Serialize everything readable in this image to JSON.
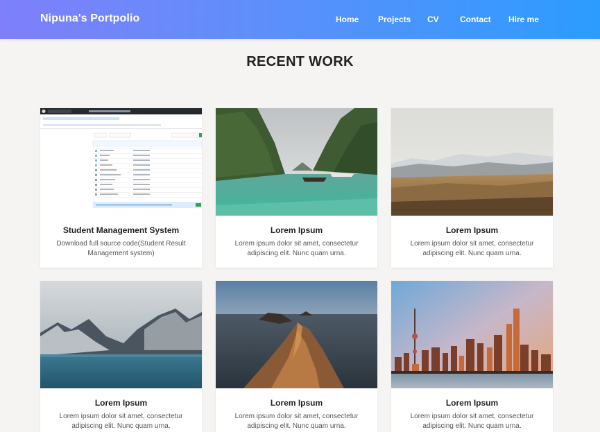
{
  "brand": "Nipuna's Portpolio",
  "nav": [
    {
      "label": "Home"
    },
    {
      "label": "Projects"
    },
    {
      "label": "CV"
    },
    {
      "label": "Contact"
    },
    {
      "label": "Hire me"
    }
  ],
  "section_title": "RECENT WORK",
  "cards": [
    {
      "title": "Student Management System",
      "desc": "Download full source code(Student Result Management system)",
      "image": "github-repo-screenshot"
    },
    {
      "title": "Lorem Ipsum",
      "desc": "Lorem ipsum dolor sit amet, consectetur adipiscing elit. Nunc quam urna.",
      "image": "tropical-lagoon-boats"
    },
    {
      "title": "Lorem Ipsum",
      "desc": "Lorem ipsum dolor sit amet, consectetur adipiscing elit. Nunc quam urna.",
      "image": "dry-hills-snow-mountains"
    },
    {
      "title": "Lorem Ipsum",
      "desc": "Lorem ipsum dolor sit amet, consectetur adipiscing elit. Nunc quam urna.",
      "image": "mountain-lake"
    },
    {
      "title": "Lorem Ipsum",
      "desc": "Lorem ipsum dolor sit amet, consectetur adipiscing elit. Nunc quam urna.",
      "image": "coastal-cliffs-sunset"
    },
    {
      "title": "Lorem Ipsum",
      "desc": "Lorem ipsum dolor sit amet, consectetur adipiscing elit. Nunc quam urna.",
      "image": "city-skyline-sunset"
    }
  ]
}
